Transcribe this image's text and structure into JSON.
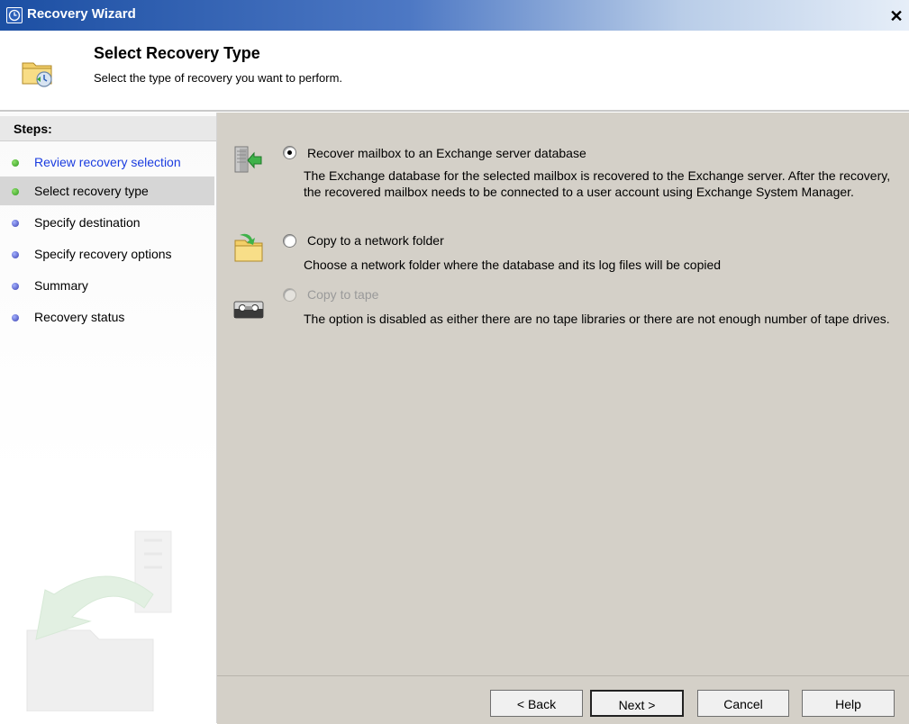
{
  "window": {
    "title": "Recovery Wizard",
    "close_glyph": "✕"
  },
  "header": {
    "title": "Select Recovery Type",
    "subtitle": "Select the type of recovery you want to perform."
  },
  "steps": {
    "title": "Steps:",
    "items": [
      {
        "label": "Review recovery selection",
        "state": "link"
      },
      {
        "label": "Select recovery type",
        "state": "current"
      },
      {
        "label": "Specify destination",
        "state": "pending"
      },
      {
        "label": "Specify recovery options",
        "state": "pending"
      },
      {
        "label": "Summary",
        "state": "pending"
      },
      {
        "label": "Recovery status",
        "state": "pending"
      }
    ]
  },
  "options": [
    {
      "label": "Recover mailbox to an Exchange server database",
      "description": "The Exchange database for the selected mailbox is recovered to the Exchange server.  After the recovery, the recovered mailbox needs to be connected to a user account using Exchange System Manager.",
      "checked": true,
      "enabled": true,
      "icon": "exchange-server-icon"
    },
    {
      "label": "Copy to a network folder",
      "description": "Choose a network folder where the database and its log files will be copied",
      "checked": false,
      "enabled": true,
      "icon": "network-folder-icon"
    },
    {
      "label": "Copy to tape",
      "description": "The option is disabled as either there are no tape libraries or there are not enough number of tape drives.",
      "checked": false,
      "enabled": false,
      "icon": "tape-icon"
    }
  ],
  "buttons": {
    "back": "< Back",
    "next": "Next >",
    "cancel": "Cancel",
    "help": "Help"
  },
  "colors": {
    "title_bar": "#1c4fa3",
    "content_bg": "#d4d0c8",
    "link": "#1a3ce0",
    "done_dot": "#2f9a1e",
    "pending_dot": "#3a3fb0"
  }
}
